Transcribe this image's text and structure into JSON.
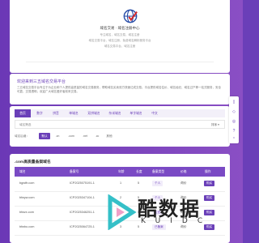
{
  "hero": {
    "brand": "域名交易  ·  域名注册中心",
    "lines": [
      "专注域名，域名交易，域名注册",
      "域名交易平台，域名注册，免费域名解析服务平台",
      "域名交易平台，域名注册"
    ]
  },
  "welcome": {
    "title": "欢迎来到三五域名交易平台",
    "text": "三五域名交易平台专注于为企业和个人提供高质量的域名交易服务，帮助域名买卖双方快速达成交易。平台提供域名估价、域名经纪、域名过户等一站式服务，安全可靠，交易透明，欢迎广大域名爱好者前来交易。"
  },
  "tabs": [
    "首页",
    "数字",
    "拼音",
    "单域名",
    "双拼域名",
    "杂米域名",
    "单字域名",
    "中文"
  ],
  "filter": {
    "placeholder": "域名筛选",
    "sort": "排序 ▾"
  },
  "pills": {
    "label": "域名后缀：",
    "items": [
      "默认",
      ".cn",
      ".com",
      ".net",
      ".cc",
      "其他"
    ]
  },
  "table": {
    "title": ".com高质量备案域名",
    "columns": [
      "域名",
      "备案号",
      "年龄",
      "长度",
      "备案类型",
      "价格",
      "操作"
    ],
    "rows": [
      {
        "domain": "bgwtfr.com",
        "icp": "ICP2025075191-1",
        "age": "1",
        "len": "5",
        "type": "个人",
        "price": "询价",
        "op": "购买"
      },
      {
        "domain": "bfwyw.com",
        "icp": "ICP2025347104-1",
        "age": "2",
        "len": "5",
        "type": "个人",
        "price": "询价",
        "op": "购买"
      },
      {
        "domain": "bfwzx.com",
        "icp": "ICP2025346251-1",
        "age": "1",
        "len": "5",
        "type": "企业",
        "price": "询价",
        "op": "购买"
      },
      {
        "domain": "bfwbo.com",
        "icp": "ICP2025064725-1",
        "age": "3",
        "len": "5",
        "type": "已备案",
        "price": "询价",
        "op": "购买"
      }
    ]
  },
  "watermark": {
    "main": "酷数据",
    "sub": "KUIDC"
  },
  "colors": {
    "accent": "#6a3fb8",
    "background": "#6b38b6"
  }
}
